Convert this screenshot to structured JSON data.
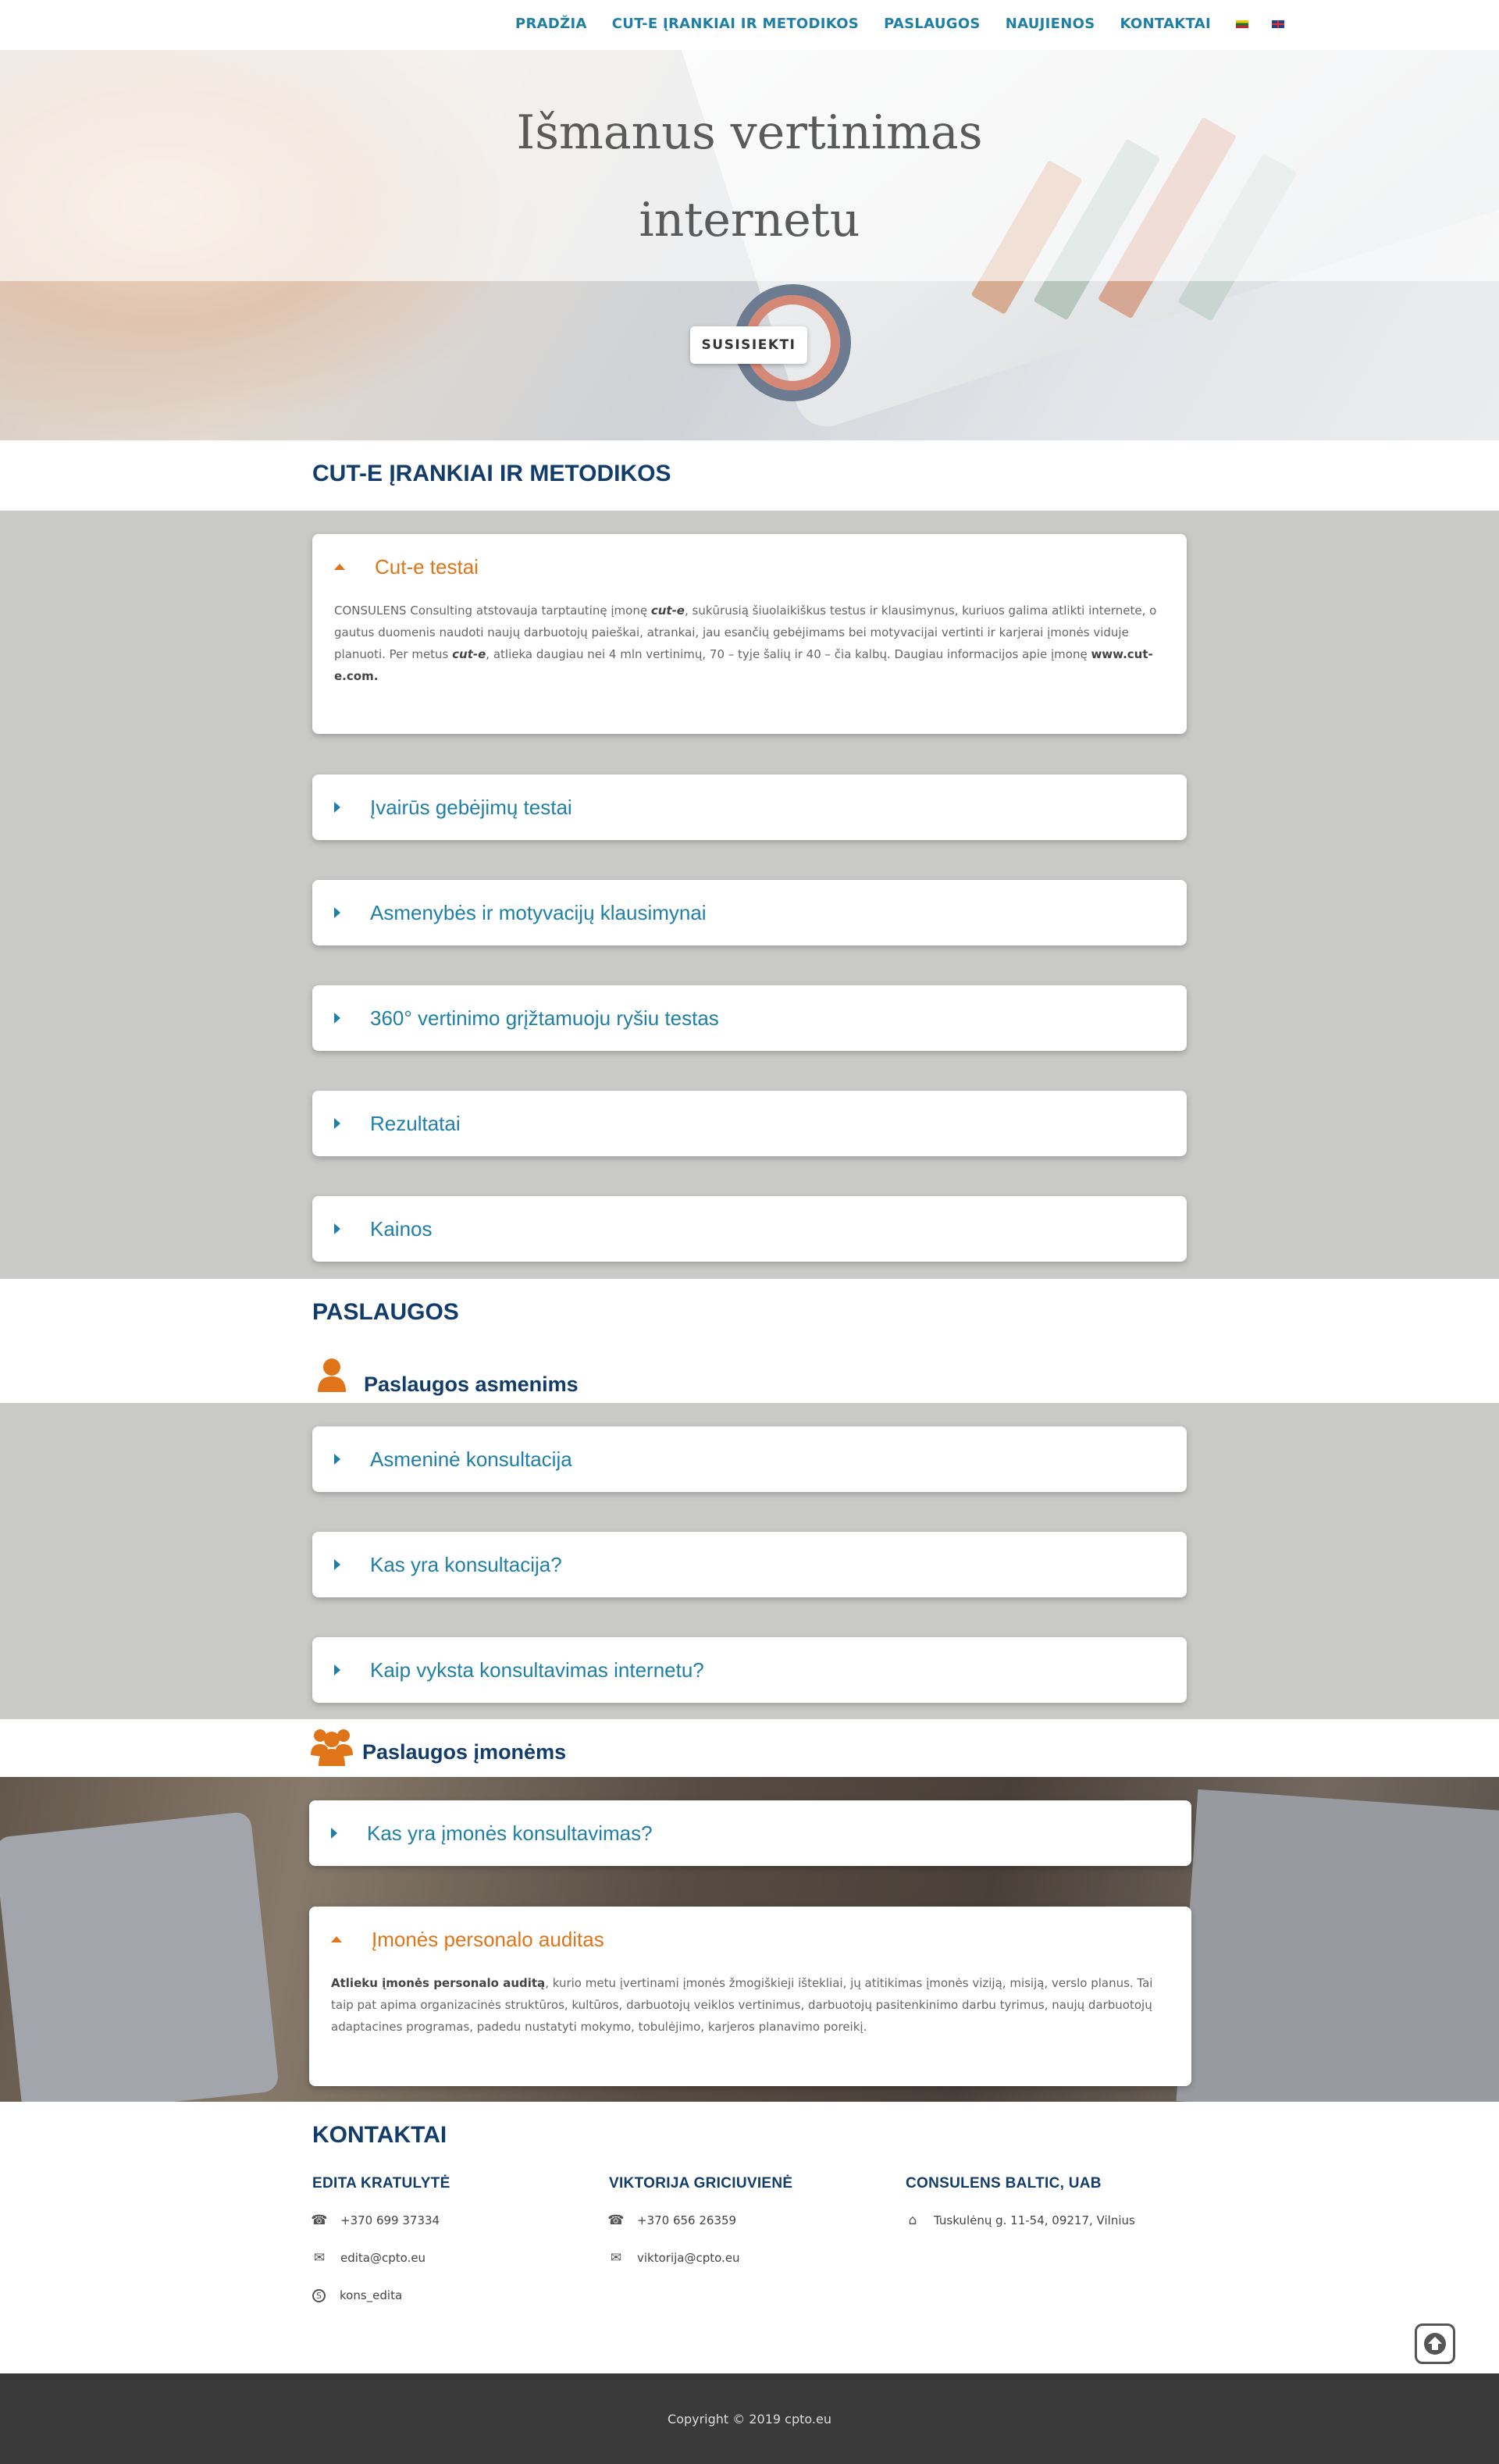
{
  "nav": {
    "items": [
      "PRADŽIA",
      "CUT-E ĮRANKIAI IR METODIKOS",
      "PASLAUGOS",
      "NAUJIENOS",
      "KONTAKTAI"
    ],
    "flags": [
      "lt-flag-icon",
      "en-flag-icon"
    ]
  },
  "hero": {
    "title_line1": "Išmanus vertinimas",
    "title_line2": "internetu",
    "button": "SUSISIEKTI"
  },
  "cute": {
    "title": "CUT-E ĮRANKIAI IR METODIKOS",
    "items": [
      {
        "title": "Cut-e testai",
        "open": true,
        "body_parts": {
          "t1": "CONSULENS Consulting atstovauja tarptautinę įmonę ",
          "b1": "cut-e",
          "t2": ", sukūrusią šiuolaikiškus testus ir klausimynus, kuriuos galima atlikti internete, o gautus duomenis naudoti naujų darbuotojų paieškai, atrankai, jau esančių gebėjimams bei motyvacijai vertinti ir karjerai įmonės viduje planuoti. Per metus ",
          "b2": "cut-e",
          "t3": ", atlieka daugiau nei 4 mln vertinimų, 70 – tyje šalių ir 40 – čia kalbų. Daugiau informacijos apie įmonę ",
          "b3": "www.cut-e.com."
        }
      },
      {
        "title": "Įvairūs gebėjimų testai"
      },
      {
        "title": "Asmenybės ir motyvacijų klausimynai"
      },
      {
        "title": "360° vertinimo grįžtamuoju ryšiu testas"
      },
      {
        "title": "Rezultatai"
      },
      {
        "title": "Kainos"
      }
    ]
  },
  "services": {
    "title": "PASLAUGOS",
    "individual_title": "Paslaugos asmenims",
    "individual_items": [
      "Asmeninė konsultacija",
      "Kas yra konsultacija?",
      "Kaip vyksta konsultavimas internetu?"
    ],
    "company_title": "Paslaugos įmonėms",
    "company_items": [
      {
        "title": "Kas yra įmonės konsultavimas?"
      },
      {
        "title": "Įmonės personalo auditas",
        "open": true,
        "body_bold": "Atlieku įmonės personalo auditą",
        "body_text": ", kurio metu įvertinami įmonės žmogiškieji ištekliai, jų atitikimas įmonės viziją, misiją, verslo planus. Tai taip pat apima organizacinės struktūros, kultūros, darbuotojų veiklos vertinimus, darbuotojų pasitenkinimo darbu tyrimus, naujų darbuotojų adaptacines programas, padedu nustatyti mokymo, tobulėjimo, karjeros planavimo poreikį."
      }
    ]
  },
  "contacts": {
    "title": "KONTAKTAI",
    "people": [
      {
        "name": "EDITA KRATULYTĖ",
        "phone": "+370 699 37334",
        "email": "edita@cpto.eu",
        "skype": "kons_edita"
      },
      {
        "name": "VIKTORIJA GRICIUVIENĖ",
        "phone": "+370 656 26359",
        "email": "viktorija@cpto.eu"
      },
      {
        "name": "CONSULENS BALTIC, UAB",
        "address": "Tuskulėnų g. 11-54, 09217, Vilnius"
      }
    ]
  },
  "footer": {
    "copyright": "Copyright © 2019 cpto.eu"
  },
  "colors": {
    "brand_blue": "#1f7fa6",
    "heading_navy": "#123d6b",
    "accent_orange": "#e07418",
    "band_gray": "#c9c9c8",
    "footer_dark": "#3a3a3a"
  }
}
